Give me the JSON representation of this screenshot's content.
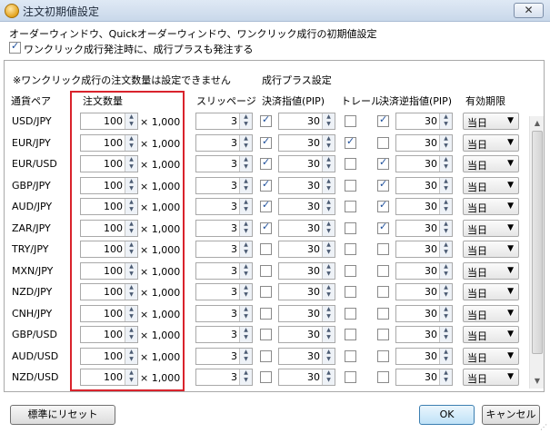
{
  "window": {
    "title": "注文初期値設定",
    "close_glyph": "✕"
  },
  "description": "オーダーウィンドウ、Quickオーダーウィンドウ、ワンクリック成行の初期値設定",
  "options": {
    "oneclick_plus_label": "ワンクリック成行発注時に、成行プラスも発注する",
    "oneclick_plus_checked": true
  },
  "note": "※ワンクリック成行の注文数量は設定できません",
  "plus_header": "成行プラス設定",
  "headers": {
    "pair": "通貨ペア",
    "qty": "注文数量",
    "slip": "スリッページ",
    "limit": "決済指値(PIP)",
    "trail": "トレール",
    "stop": "決済逆指値(PIP)",
    "expiry": "有効期限"
  },
  "multiplier": "× 1,000",
  "rows": [
    {
      "pair": "USD/JPY",
      "qty": "100",
      "slip": "3",
      "limit_on": true,
      "limit": "30",
      "trail_on": false,
      "stop_on": true,
      "stop": "30",
      "expiry": "当日"
    },
    {
      "pair": "EUR/JPY",
      "qty": "100",
      "slip": "3",
      "limit_on": true,
      "limit": "30",
      "trail_on": true,
      "stop_on": false,
      "stop": "30",
      "expiry": "当日"
    },
    {
      "pair": "EUR/USD",
      "qty": "100",
      "slip": "3",
      "limit_on": true,
      "limit": "30",
      "trail_on": false,
      "stop_on": true,
      "stop": "30",
      "expiry": "当日"
    },
    {
      "pair": "GBP/JPY",
      "qty": "100",
      "slip": "3",
      "limit_on": true,
      "limit": "30",
      "trail_on": false,
      "stop_on": true,
      "stop": "30",
      "expiry": "当日"
    },
    {
      "pair": "AUD/JPY",
      "qty": "100",
      "slip": "3",
      "limit_on": true,
      "limit": "30",
      "trail_on": false,
      "stop_on": true,
      "stop": "30",
      "expiry": "当日"
    },
    {
      "pair": "ZAR/JPY",
      "qty": "100",
      "slip": "3",
      "limit_on": true,
      "limit": "30",
      "trail_on": false,
      "stop_on": true,
      "stop": "30",
      "expiry": "当日"
    },
    {
      "pair": "TRY/JPY",
      "qty": "100",
      "slip": "3",
      "limit_on": false,
      "limit": "30",
      "trail_on": false,
      "stop_on": false,
      "stop": "30",
      "expiry": "当日"
    },
    {
      "pair": "MXN/JPY",
      "qty": "100",
      "slip": "3",
      "limit_on": false,
      "limit": "30",
      "trail_on": false,
      "stop_on": false,
      "stop": "30",
      "expiry": "当日"
    },
    {
      "pair": "NZD/JPY",
      "qty": "100",
      "slip": "3",
      "limit_on": false,
      "limit": "30",
      "trail_on": false,
      "stop_on": false,
      "stop": "30",
      "expiry": "当日"
    },
    {
      "pair": "CNH/JPY",
      "qty": "100",
      "slip": "3",
      "limit_on": false,
      "limit": "30",
      "trail_on": false,
      "stop_on": false,
      "stop": "30",
      "expiry": "当日"
    },
    {
      "pair": "GBP/USD",
      "qty": "100",
      "slip": "3",
      "limit_on": false,
      "limit": "30",
      "trail_on": false,
      "stop_on": false,
      "stop": "30",
      "expiry": "当日"
    },
    {
      "pair": "AUD/USD",
      "qty": "100",
      "slip": "3",
      "limit_on": false,
      "limit": "30",
      "trail_on": false,
      "stop_on": false,
      "stop": "30",
      "expiry": "当日"
    },
    {
      "pair": "NZD/USD",
      "qty": "100",
      "slip": "3",
      "limit_on": false,
      "limit": "30",
      "trail_on": false,
      "stop_on": false,
      "stop": "30",
      "expiry": "当日"
    }
  ],
  "buttons": {
    "reset": "標準にリセット",
    "ok": "OK",
    "cancel": "キャンセル"
  },
  "highlight_color": "#d9232c"
}
